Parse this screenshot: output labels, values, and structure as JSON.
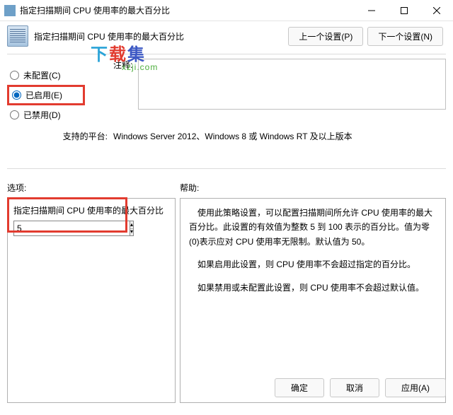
{
  "window": {
    "title": "指定扫描期间 CPU 使用率的最大百分比"
  },
  "header": {
    "title": "指定扫描期间 CPU 使用率的最大百分比",
    "prev": "上一个设置(P)",
    "next": "下一个设置(N)"
  },
  "radios": {
    "notconfig": "未配置(C)",
    "enabled": "已启用(E)",
    "disabled": "已禁用(D)"
  },
  "comment_label": "注释:",
  "platform_label": "支持的平台:",
  "platform_value": "Windows Server 2012、Windows 8 或 Windows RT 及以上版本",
  "options_header": "选项:",
  "help_header": "帮助:",
  "option_field": {
    "label": "指定扫描期间 CPU 使用率的最大百分比",
    "value": "5"
  },
  "help_paragraphs": [
    "使用此策略设置，可以配置扫描期间所允许 CPU 使用率的最大百分比。此设置的有效值为整数 5 到 100 表示的百分比。值为零(0)表示应对 CPU 使用率无限制。默认值为 50。",
    "如果启用此设置，则 CPU 使用率不会超过指定的百分比。",
    "如果禁用或未配置此设置，则 CPU 使用率不会超过默认值。"
  ],
  "footer": {
    "ok": "确定",
    "cancel": "取消",
    "apply": "应用(A)"
  },
  "watermark": {
    "cn": "下载集",
    "en": "xzji.com"
  }
}
